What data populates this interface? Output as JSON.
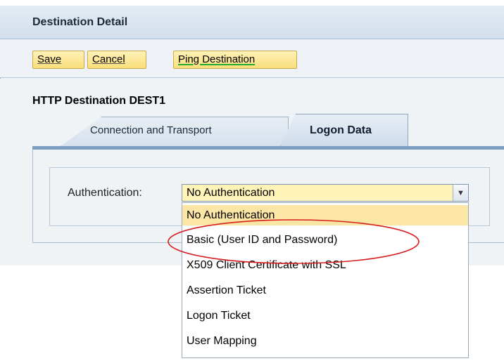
{
  "panel": {
    "title": "Destination Detail"
  },
  "toolbar": {
    "save_label": "Save",
    "cancel_label": "Cancel",
    "ping_label": "Ping Destination"
  },
  "destination": {
    "title": "HTTP Destination DEST1"
  },
  "tabs": [
    {
      "label": "Connection and Transport",
      "active": false
    },
    {
      "label": "Logon Data",
      "active": true
    }
  ],
  "authentication": {
    "label": "Authentication:",
    "selected": "No Authentication",
    "options": [
      "No Authentication",
      "Basic (User ID and Password)",
      "X509 Client Certificate with SSL",
      "Assertion Ticket",
      "Logon Ticket",
      "User Mapping"
    ]
  },
  "colors": {
    "button_fill": "#f9de7a",
    "tab_underline": "#7f9fc2",
    "selected_option": "#fbe6a6",
    "annotation": "#d81e1e"
  }
}
